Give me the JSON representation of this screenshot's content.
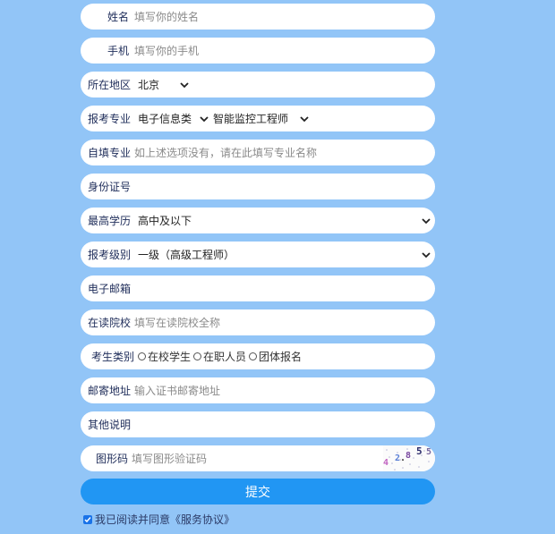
{
  "form": {
    "name": {
      "label": "姓名",
      "placeholder": "填写你的姓名"
    },
    "phone": {
      "label": "手机",
      "placeholder": "填写你的手机"
    },
    "region": {
      "label": "所在地区",
      "selected": "北京"
    },
    "major": {
      "label": "报考专业",
      "category": "电子信息类",
      "specialty": "智能监控工程师"
    },
    "custom_major": {
      "label": "自填专业",
      "placeholder": "如上述选项没有，请在此填写专业名称"
    },
    "id_number": {
      "label": "身份证号"
    },
    "education": {
      "label": "最高学历",
      "selected": "高中及以下"
    },
    "level": {
      "label": "报考级别",
      "selected": "一级（高级工程师）"
    },
    "email": {
      "label": "电子邮箱"
    },
    "school": {
      "label": "在读院校",
      "placeholder": "填写在读院校全称"
    },
    "candidate_type": {
      "label": "考生类别",
      "options": [
        "在校学生",
        "在职人员",
        "团体报名"
      ]
    },
    "address": {
      "label": "邮寄地址",
      "placeholder": "输入证书邮寄地址"
    },
    "notes": {
      "label": "其他说明"
    },
    "captcha": {
      "label": "图形码",
      "placeholder": "填写图形验证码",
      "chars": [
        "4",
        "2",
        ".",
        "8",
        "5",
        "5"
      ]
    },
    "submit_label": "提交",
    "agree_label": "我已阅读并同意《服务协议》"
  },
  "colors": {
    "background": "#92c5f7",
    "submit": "#2196f3",
    "label": "#1f2d5a"
  }
}
